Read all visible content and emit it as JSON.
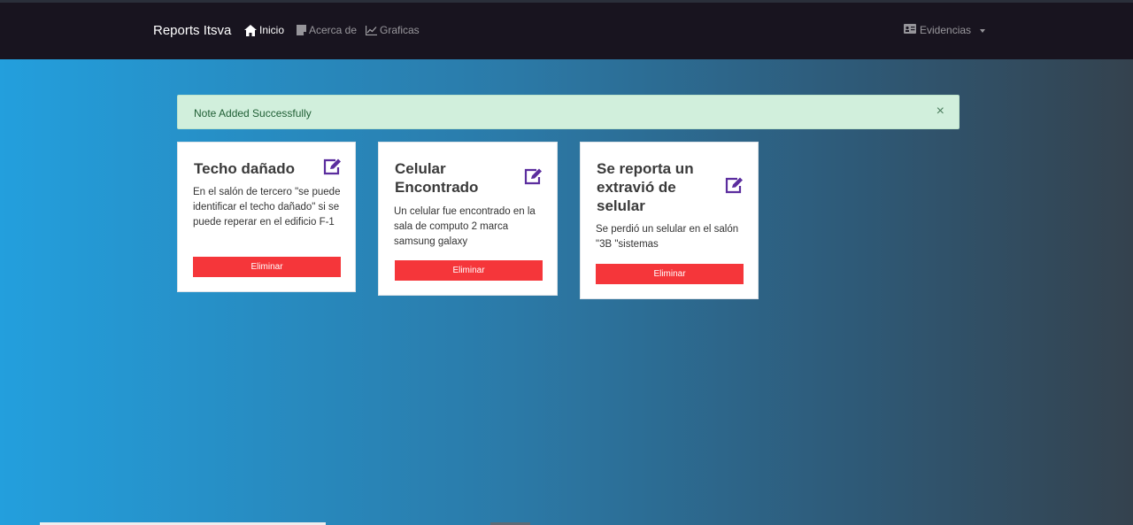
{
  "navbar": {
    "brand": "Reports Itsva",
    "links": [
      {
        "label": "Inicio",
        "icon": "home-icon"
      },
      {
        "label": "Acerca de",
        "icon": "note-icon"
      },
      {
        "label": "Graficas",
        "icon": "chart-icon"
      }
    ],
    "dropdown": {
      "label": "Evidencias",
      "icon": "id-card-icon"
    }
  },
  "alert": {
    "message": "Note Added Successfully",
    "close": "×",
    "color": "#d1efdc"
  },
  "notes": [
    {
      "title": "Techo dañado",
      "body": "En el salón de tercero \"se puede identificar el techo dañado\" si se puede reperar en el edificio F-1",
      "delete_label": "Eliminar"
    },
    {
      "title": "Celular Encontrado",
      "body": "Un celular fue encontrado en la sala de computo 2 marca samsung galaxy",
      "delete_label": "Eliminar"
    },
    {
      "title": "Se reporta un extravió de selular",
      "body": "Se perdió un selular en el salón \"3B \"sistemas",
      "delete_label": "Eliminar"
    }
  ],
  "colors": {
    "navbar": "#18141f",
    "accent_edit": "#5b2d9e",
    "delete": "#f5363a"
  }
}
